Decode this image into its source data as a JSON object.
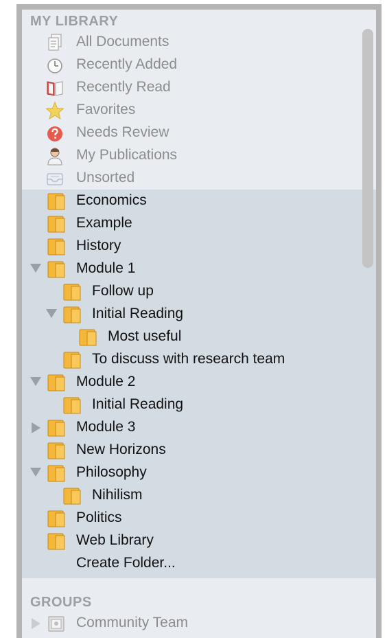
{
  "library": {
    "header": "MY LIBRARY",
    "items": [
      {
        "label": "All Documents",
        "icon": "documents-icon"
      },
      {
        "label": "Recently Added",
        "icon": "clock-icon"
      },
      {
        "label": "Recently Read",
        "icon": "book-icon"
      },
      {
        "label": "Favorites",
        "icon": "star-icon"
      },
      {
        "label": "Needs Review",
        "icon": "question-icon"
      },
      {
        "label": "My Publications",
        "icon": "person-icon"
      },
      {
        "label": "Unsorted",
        "icon": "inbox-icon"
      }
    ]
  },
  "folders": [
    {
      "label": "Economics"
    },
    {
      "label": "Example"
    },
    {
      "label": "History"
    },
    {
      "label": "Module 1",
      "expanded": true
    },
    {
      "label": "Follow up"
    },
    {
      "label": "Initial Reading",
      "expanded": true
    },
    {
      "label": "Most useful"
    },
    {
      "label": "To discuss with research team"
    },
    {
      "label": "Module 2",
      "expanded": true
    },
    {
      "label": "Initial Reading"
    },
    {
      "label": "Module 3",
      "expanded": false
    },
    {
      "label": "New Horizons"
    },
    {
      "label": "Philosophy",
      "expanded": true
    },
    {
      "label": "Nihilism"
    },
    {
      "label": "Politics"
    },
    {
      "label": "Web Library"
    }
  ],
  "create_folder": "Create Folder...",
  "groups": {
    "header": "GROUPS",
    "items": [
      {
        "label": "Community Team",
        "icon": "group-icon",
        "expanded": false
      }
    ]
  },
  "colors": {
    "panel_bg": "#e9edf2",
    "folder_area_bg": "#d3dbe3",
    "header_text": "#9aa0a7",
    "muted_text": "#8c8c8c",
    "folder": "#f4b73a"
  }
}
